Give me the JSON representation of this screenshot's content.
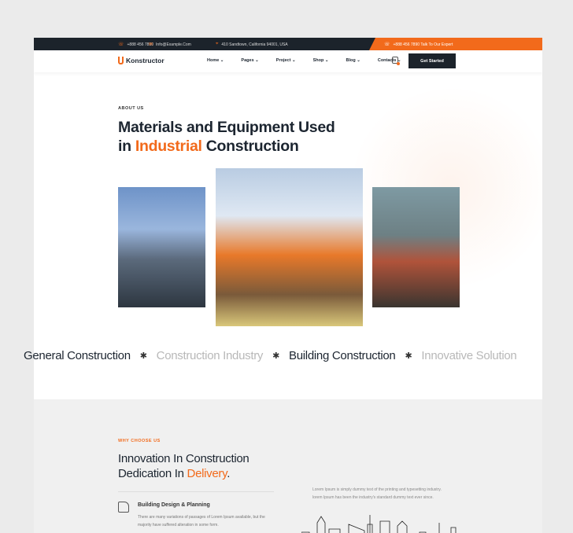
{
  "topbar": {
    "phone": "+888 456 7890",
    "email": "Info@Example.Com",
    "address": "410 Sandtown, California 94001, USA",
    "expert": "+888 456 7890 Talk To Our Expert"
  },
  "nav": {
    "logo": "Konstructor",
    "items": [
      "Home",
      "Pages",
      "Project",
      "Shop",
      "Blog",
      "Contacts"
    ],
    "cta": "Get Started"
  },
  "about": {
    "eyebrow": "ABOUT US",
    "title_line1": "Materials and Equipment Used",
    "title_in": "in ",
    "title_accent": "Industrial",
    "title_end": " Construction"
  },
  "ticker": [
    "General Construction",
    "Construction Industry",
    "Building Construction",
    "Innovative Solution"
  ],
  "why": {
    "eyebrow": "WHY CHOOSE US",
    "title_line1": "Innovation In Construction",
    "title_line2": "Dedication In ",
    "title_accent": "Delivery",
    "title_dot": ".",
    "intro": "Lorem Ipsum is simply dummy text of the printing and typesetting industry. lorem Ipsum has been the industry's standard dummy text ever since.",
    "feature_title": "Building Design & Planning",
    "feature_desc": "There are many variations of passages of Lorem Ipsum available, but the majority have suffered alteration in some form."
  },
  "colors": {
    "accent": "#f26a1b",
    "dark": "#1c232b"
  }
}
